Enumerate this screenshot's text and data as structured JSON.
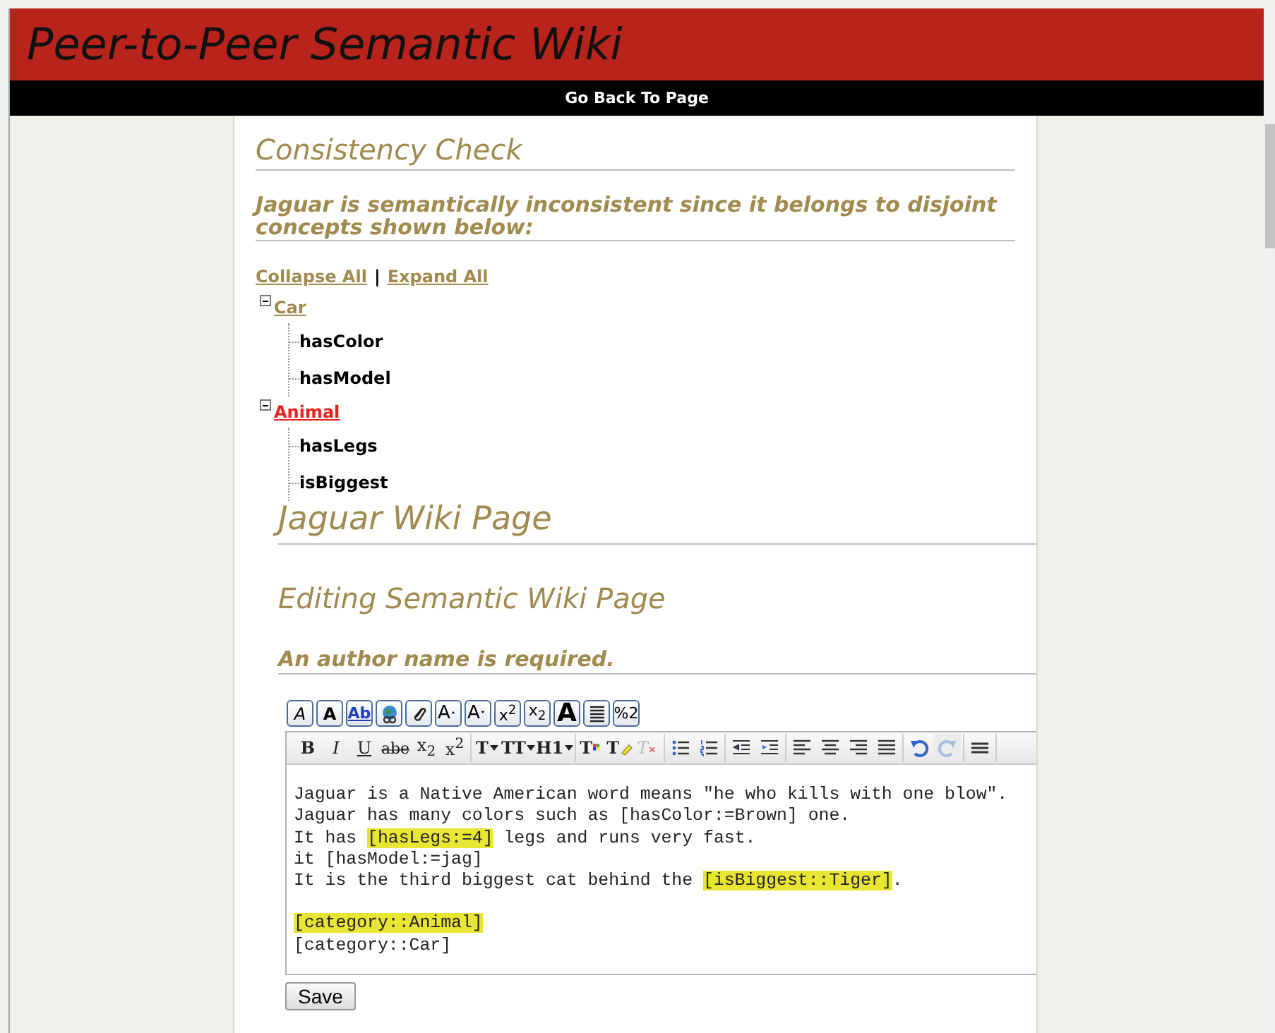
{
  "site": {
    "title": "Peer-to-Peer Semantic Wiki",
    "nav_link": "Go Back To Page"
  },
  "consistency": {
    "heading": "Consistency Check",
    "message": "Jaguar is semantically inconsistent since it belongs to disjoint concepts shown below:",
    "controls": [
      "Collapse All",
      "|",
      "Expand All"
    ],
    "tree": [
      {
        "label": "Car",
        "expanded": true,
        "color": "#a08a4e",
        "children": [
          {
            "label": "hasColor"
          },
          {
            "label": "hasModel"
          }
        ]
      },
      {
        "label": "Animal",
        "expanded": true,
        "color": "#e8201e",
        "children": [
          {
            "label": "hasLegs"
          },
          {
            "label": "isBiggest"
          }
        ]
      }
    ]
  },
  "page": {
    "title": "Jaguar Wiki Page",
    "subtitle": "Editing Semantic Wiki Page",
    "warning": "An author name is required."
  },
  "wiki_toolbar": [
    {
      "kind": "italic",
      "label": "A"
    },
    {
      "kind": "bold",
      "label": "A"
    },
    {
      "kind": "link",
      "label": "Ab"
    },
    {
      "kind": "globe"
    },
    {
      "kind": "clip"
    },
    {
      "kind": "grow",
      "label": "A"
    },
    {
      "kind": "shrink",
      "label": "A"
    },
    {
      "kind": "plain",
      "label": "x$^{2}$"
    },
    {
      "kind": "plain",
      "label": "x$_{2}$"
    },
    {
      "kind": "heavy",
      "label": "A"
    },
    {
      "kind": "lines"
    },
    {
      "kind": "plain",
      "label": "%2"
    }
  ],
  "editor_toolbar": [
    [
      {
        "kind": "serif",
        "label": "B"
      },
      {
        "kind": "italic",
        "label": "I"
      },
      {
        "kind": "underline",
        "label": "U"
      },
      {
        "kind": "strike",
        "label": "abe"
      },
      {
        "kind": "plain",
        "label": "x$_{2}$"
      },
      {
        "kind": "plain",
        "label": "x$^{2}$"
      }
    ],
    [
      {
        "kind": "dropdown",
        "label": "T"
      },
      {
        "kind": "dropdown",
        "label": "TT"
      },
      {
        "kind": "dropdown",
        "label": "H1"
      }
    ],
    [
      {
        "kind": "textcolor",
        "label": "T"
      },
      {
        "kind": "bgcolor",
        "label": "T"
      },
      {
        "kind": "clear",
        "label": "T"
      }
    ],
    [
      {
        "kind": "bullets"
      },
      {
        "kind": "numbers"
      }
    ],
    [
      {
        "kind": "outdent"
      },
      {
        "kind": "indent"
      }
    ],
    [
      {
        "kind": "left"
      },
      {
        "kind": "center"
      },
      {
        "kind": "right"
      },
      {
        "kind": "justify"
      }
    ],
    [
      {
        "kind": "undo"
      },
      {
        "kind": "redo",
        "disabled": true
      }
    ],
    [
      {
        "kind": "more"
      }
    ]
  ],
  "editor_text": [
    [
      [
        {
          "text": "Jaguar is a Native American word means \"he who kills with one blow\"."
        }
      ],
      [
        {
          "text": "Jaguar has many colors such as [hasColor:=Brown] one."
        }
      ],
      [
        {
          "text": "It has "
        },
        {
          "text": "[hasLegs:=4]",
          "highlighted": true
        },
        {
          "text": " legs and runs very fast."
        }
      ],
      [
        {
          "text": "it [hasModel:=jag]"
        }
      ],
      [
        {
          "text": "It is the third biggest cat behind the "
        },
        {
          "text": "[isBiggest::Tiger]",
          "highlighted": true
        },
        {
          "text": "."
        }
      ]
    ],
    [
      [
        {
          "text": "[category::Animal]",
          "highlighted": true
        }
      ],
      [
        {
          "text": "[category::Car]"
        }
      ]
    ]
  ],
  "save_button": "Save"
}
